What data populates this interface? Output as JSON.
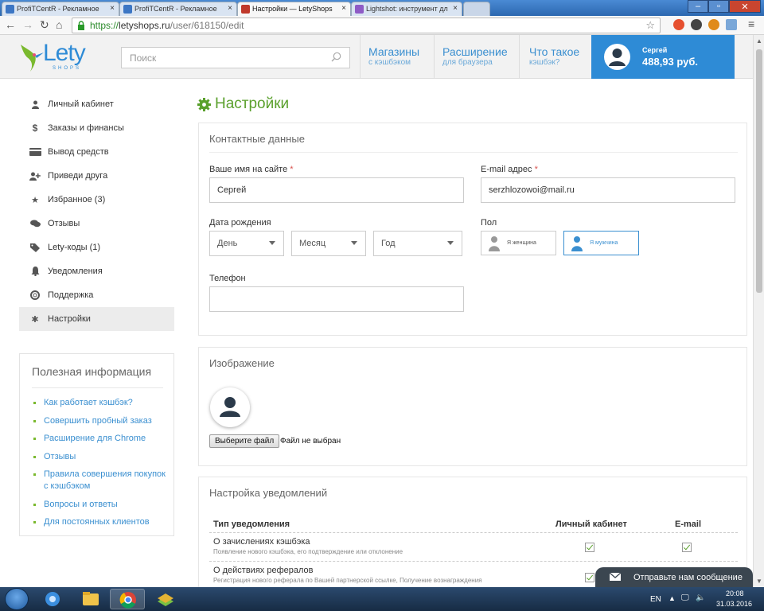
{
  "browser": {
    "tabs": [
      {
        "title": "ProfiTCentR - Рекламное",
        "close": "×"
      },
      {
        "title": "ProfiTCentR - Рекламное",
        "close": "×"
      },
      {
        "title": "Настройки — LetyShops",
        "close": "×"
      },
      {
        "title": "Lightshot: инструмент дл",
        "close": "×"
      }
    ],
    "url_scheme": "https://",
    "url_host": "letyshops.ru",
    "url_path": "/user/618150/edit"
  },
  "header": {
    "logo_word": "Lety",
    "logo_sub": "SHOPS",
    "search_placeholder": "Поиск",
    "nav": [
      {
        "title": "Магазины",
        "sub": "с кэшбэком"
      },
      {
        "title": "Расширение",
        "sub": "для браузера"
      },
      {
        "title": "Что такое",
        "sub": "кэшбэк?"
      }
    ],
    "user_name": "Сергей",
    "balance": "488,93 руб."
  },
  "sidebar": {
    "items": [
      {
        "label": "Личный кабинет",
        "icon": "user-icon"
      },
      {
        "label": "Заказы и финансы",
        "icon": "dollar-icon"
      },
      {
        "label": "Вывод средств",
        "icon": "card-icon"
      },
      {
        "label": "Приведи друга",
        "icon": "add-user-icon"
      },
      {
        "label": "Избранное (3)",
        "icon": "star-icon"
      },
      {
        "label": "Отзывы",
        "icon": "comments-icon"
      },
      {
        "label": "Lety-коды (1)",
        "icon": "tags-icon"
      },
      {
        "label": "Уведомления",
        "icon": "bell-icon"
      },
      {
        "label": "Поддержка",
        "icon": "lifebuoy-icon"
      },
      {
        "label": "Настройки",
        "icon": "gear-icon"
      }
    ],
    "info_title": "Полезная информация",
    "info_links": [
      "Как работает кэшбэк?",
      "Совершить пробный заказ",
      "Расширение для Chrome",
      "Отзывы",
      "Правила совершения покупок с кэшбэком",
      "Вопросы и ответы",
      "Для постоянных клиентов"
    ]
  },
  "main": {
    "title": "Настройки",
    "contact": {
      "heading": "Контактные данные",
      "name_label": "Ваше имя на сайте",
      "name_value": "Сергей",
      "email_label": "E-mail адрес",
      "email_value": "serzhlozowoi@mail.ru",
      "required_mark": "*",
      "birth_label": "Дата рождения",
      "day": "День",
      "month": "Месяц",
      "year": "Год",
      "gender_label": "Пол",
      "female": "Я женщина",
      "male": "Я мужчина",
      "phone_label": "Телефон",
      "phone_value": ""
    },
    "image": {
      "heading": "Изображение",
      "choose_file": "Выберите файл",
      "no_file": "Файл не выбран"
    },
    "notifications": {
      "heading": "Настройка уведомлений",
      "col_type": "Тип уведомления",
      "col_cabinet": "Личный кабинет",
      "col_email": "E-mail",
      "rows": [
        {
          "title": "О зачислениях кэшбэка",
          "desc": "Появление нового кэшбэка, его подтверждение или отклонение"
        },
        {
          "title": "О действиях рефералов",
          "desc": "Регистрация нового реферала по Вашей партнерской ссылке, Получение вознаграждения"
        }
      ]
    }
  },
  "chat": {
    "label": "Отправьте нам сообщение"
  },
  "taskbar": {
    "lang": "EN",
    "time": "20:08",
    "date": "31.03.2016"
  },
  "colors": {
    "accent": "#2e8bd6",
    "green": "#5aa02c",
    "link": "#3a8fd0"
  }
}
